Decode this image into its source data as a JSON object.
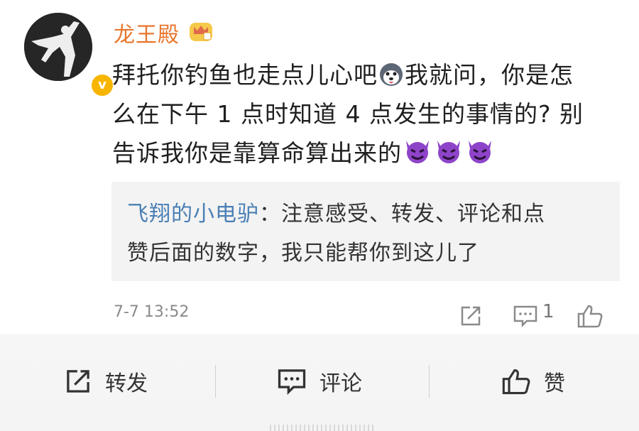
{
  "post": {
    "username": "龙王殿",
    "content_lines": [
      "拜托你钓鱼也走点儿心吧",
      "我就问，你是怎",
      "么在下午 1 点时知道 4 点发生的事情的? 别",
      "告诉我你是靠算命算出来的"
    ],
    "quote": {
      "author": "飞翔的小电驴",
      "separator": "：",
      "text_line1": "注意感受、转发、评论和点",
      "text_line2": "赞后面的数字，我只能帮你到这儿了"
    },
    "time": "7-7 13:52",
    "comment_count": "1"
  },
  "actions": {
    "repost_label": "转发",
    "comment_label": "评论",
    "like_label": "赞"
  },
  "icons": {
    "verify": "verified-badge-icon",
    "crown": "crown-icon",
    "husky": "husky-emoji-icon",
    "devil": "smiling-devil-emoji-icon"
  },
  "colors": {
    "username": "#e8762d",
    "quote_author": "#4a7fb5",
    "verify": "#f7b500",
    "devil": "#8e44c9"
  }
}
